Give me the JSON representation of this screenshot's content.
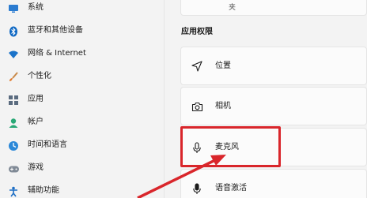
{
  "sidebar": {
    "items": [
      {
        "label": "系统",
        "icon": "monitor-icon"
      },
      {
        "label": "蓝牙和其他设备",
        "icon": "bluetooth-icon"
      },
      {
        "label": "网络 & Internet",
        "icon": "wifi-icon"
      },
      {
        "label": "个性化",
        "icon": "brush-icon"
      },
      {
        "label": "应用",
        "icon": "apps-icon"
      },
      {
        "label": "帐户",
        "icon": "person-icon"
      },
      {
        "label": "时间和语言",
        "icon": "globe-clock-icon"
      },
      {
        "label": "游戏",
        "icon": "gamepad-icon"
      },
      {
        "label": "辅助功能",
        "icon": "accessibility-icon"
      }
    ]
  },
  "main": {
    "top_card_partial": "夹",
    "section_title": "应用权限",
    "cards": [
      {
        "label": "位置",
        "icon": "location-arrow-icon"
      },
      {
        "label": "相机",
        "icon": "camera-icon"
      },
      {
        "label": "麦克风",
        "icon": "microphone-icon"
      },
      {
        "label": "语音激活",
        "icon": "voice-activation-icon"
      }
    ]
  },
  "colors": {
    "highlight": "#d9262b",
    "accent": "#0067c0"
  }
}
